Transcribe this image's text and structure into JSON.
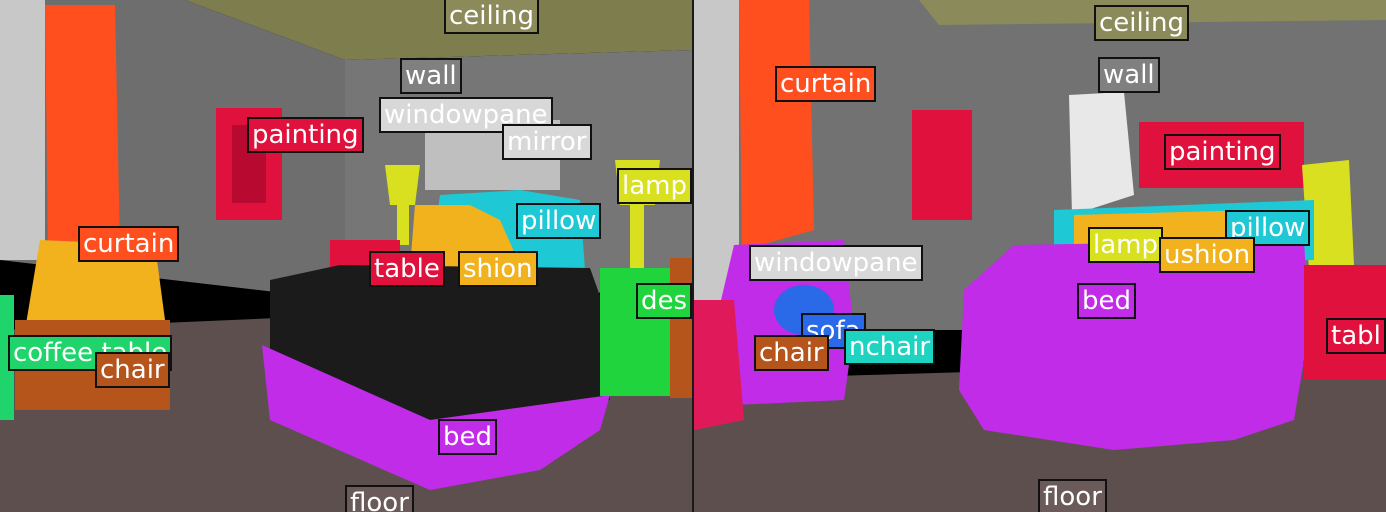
{
  "colors": {
    "curtain": "#ff4f1f",
    "painting": "#e0113c",
    "pillow": "#1ec8d4",
    "cushion": "#f1b21d",
    "lamp": "#d8e020",
    "bed": "#c02ce8",
    "table": "#e0113c",
    "chair": "#b5551c",
    "coffee_table": "#1fd46a",
    "desk": "#1fd43c",
    "sofa": "#2a6ae8",
    "armchair": "#1ed4c0",
    "windowpane": "#d8d8d8",
    "mirror": "#d8d8d8",
    "wall": "#808080",
    "ceiling": "#8a8a5a",
    "floor": "#6a5a5a"
  },
  "left": {
    "labels": {
      "ceiling": "ceiling",
      "wall": "wall",
      "windowpane": "windowpane",
      "painting": "painting",
      "mirror": "mirror",
      "lamp": "lamp",
      "pillow": "pillow",
      "curtain": "curtain",
      "table": "table",
      "cushion": "shion",
      "desk": "des",
      "coffee_table": "coffee table",
      "chair": "chair",
      "bed": "bed",
      "floor": "floor"
    }
  },
  "right": {
    "labels": {
      "ceiling": "ceiling",
      "wall": "wall",
      "curtain": "curtain",
      "painting": "painting",
      "pillow": "pillow",
      "lamp": "lamp",
      "cushion": "ushion",
      "windowpane": "windowpane",
      "bed": "bed",
      "sofa": "sofa",
      "chair": "chair",
      "armchair": "nchair",
      "table": "tabl",
      "floor": "floor"
    }
  }
}
